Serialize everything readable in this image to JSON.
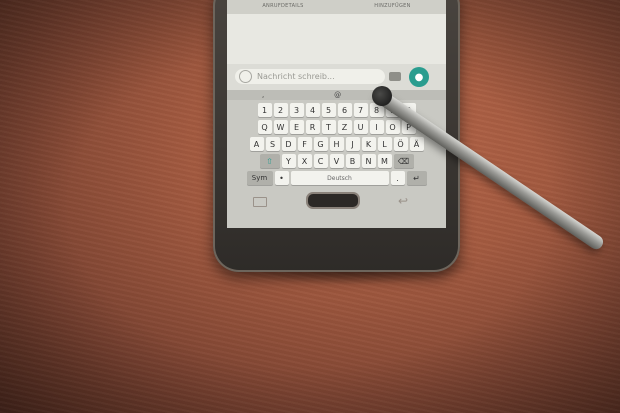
{
  "screen": {
    "tabs": [
      "ANRUFDETAILS",
      "HINZUFÜGEN"
    ],
    "input_placeholder": "Nachricht schreib...",
    "keyboard": {
      "suggest": [
        ",",
        "@",
        ""
      ],
      "row1": [
        "1",
        "2",
        "3",
        "4",
        "5",
        "6",
        "7",
        "8",
        "9",
        "0"
      ],
      "row2": [
        "Q",
        "W",
        "E",
        "R",
        "T",
        "Z",
        "U",
        "I",
        "O",
        "P"
      ],
      "row3": [
        "A",
        "S",
        "D",
        "F",
        "G",
        "H",
        "J",
        "K",
        "L",
        "Ö",
        "Ä"
      ],
      "row4": [
        "Y",
        "X",
        "C",
        "V",
        "B",
        "N",
        "M"
      ],
      "sym_label": "Sym",
      "space_label": "Deutsch"
    }
  },
  "icons": {
    "mic": "microphone-icon",
    "shift": "shift-icon",
    "enter": "enter-icon",
    "back": "back-icon"
  },
  "colors": {
    "accent": "#2a9d8f",
    "table": "#a35a40"
  }
}
